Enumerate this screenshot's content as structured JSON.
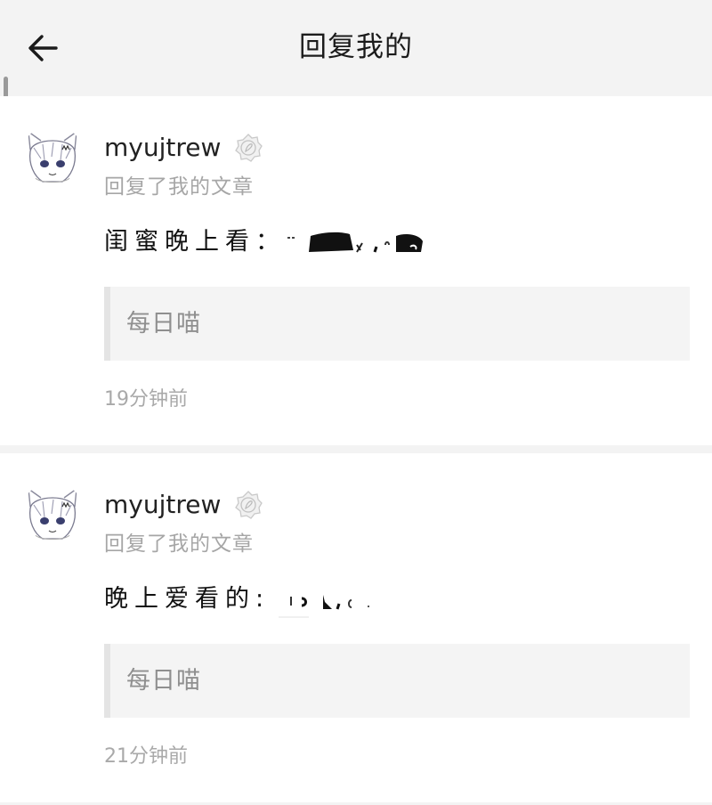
{
  "header": {
    "title": "回复我的"
  },
  "notifications": [
    {
      "username": "myujtrew",
      "action": "回复了我的文章",
      "content": "闺蜜晚上看：",
      "quote": "每日喵",
      "time": "19分钟前"
    },
    {
      "username": "myujtrew",
      "action": "回复了我的文章",
      "content": "晚上爱看的:",
      "quote": "每日喵",
      "time": "21分钟前"
    }
  ],
  "icons": {
    "back": "arrow-left-icon",
    "badge": "verified-badge-icon",
    "avatar": "anime-cat-girl-avatar"
  },
  "colors": {
    "page_bg": "#f3f3f3",
    "card_bg": "#ffffff",
    "secondary_text": "#a6a6a6",
    "quote_bg": "#f4f4f4"
  }
}
